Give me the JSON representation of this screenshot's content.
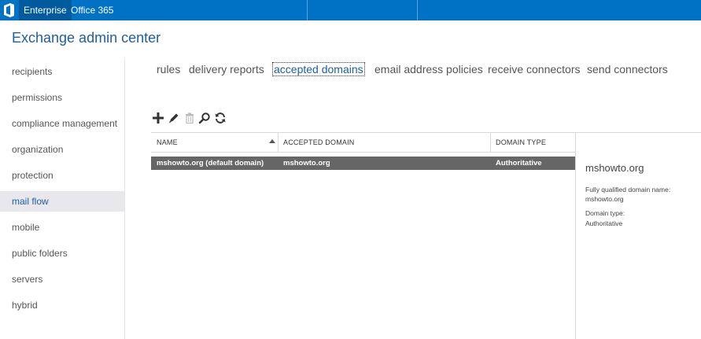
{
  "topbar": {
    "tabs": [
      {
        "label": "Enterprise",
        "active": true
      },
      {
        "label": "Office 365",
        "active": false
      }
    ],
    "brand_color": "#0072c6"
  },
  "app_title": "Exchange admin center",
  "sidebar": {
    "items": [
      {
        "label": "recipients"
      },
      {
        "label": "permissions"
      },
      {
        "label": "compliance management"
      },
      {
        "label": "organization"
      },
      {
        "label": "protection"
      },
      {
        "label": "mail flow",
        "active": true
      },
      {
        "label": "mobile"
      },
      {
        "label": "public folders"
      },
      {
        "label": "servers"
      },
      {
        "label": "hybrid"
      }
    ]
  },
  "tabs": [
    {
      "label": "rules"
    },
    {
      "label": "delivery reports"
    },
    {
      "label": "accepted domains",
      "active": true
    },
    {
      "label": "email address policies"
    },
    {
      "label": "receive connectors"
    },
    {
      "label": "send connectors"
    }
  ],
  "toolbar": {
    "icons": [
      "add-icon",
      "edit-icon",
      "delete-icon",
      "search-icon",
      "refresh-icon"
    ]
  },
  "table": {
    "columns": [
      "NAME",
      "ACCEPTED DOMAIN",
      "DOMAIN TYPE"
    ],
    "sorted_column": "NAME",
    "rows": [
      {
        "name": "mshowto.org (default domain)",
        "accepted_domain": "mshowto.org",
        "domain_type": "Authoritative",
        "selected": true
      }
    ]
  },
  "details": {
    "title": "mshowto.org",
    "fqdn_label": "Fully qualified domain name:",
    "fqdn_value": "mshowto.org",
    "type_label": "Domain type:",
    "type_value": "Authoritative"
  }
}
